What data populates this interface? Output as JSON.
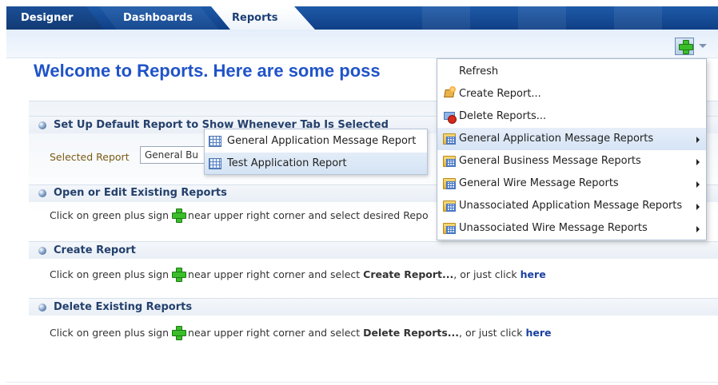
{
  "tabs": [
    {
      "label": "Designer"
    },
    {
      "label": "Dashboards"
    },
    {
      "label": "Reports"
    }
  ],
  "welcome_text": "Welcome to Reports.  Here are some poss",
  "default_section": {
    "title": "Set Up Default Report to Show Whenever Tab Is Selected",
    "selected_label": "Selected Report",
    "selected_value": "General Bu"
  },
  "open_section": {
    "title": "Open or Edit Existing Reports",
    "text_before": "Click on green plus sign",
    "text_after": "near upper right corner and select desired Repo"
  },
  "create_section": {
    "title": "Create Report",
    "text_before": "Click on green plus sign",
    "text_mid": "near upper right corner and select",
    "bold_item": "Create Report...",
    "text_end": ", or just click",
    "link": "here"
  },
  "delete_section": {
    "title": "Delete Existing Reports",
    "text_before": "Click on green plus sign",
    "text_mid": "near upper right corner and select",
    "bold_item": "Delete Reports...",
    "text_end": ", or just click",
    "link": "here"
  },
  "menu": {
    "items": [
      {
        "label": "Refresh"
      },
      {
        "label": "Create Report..."
      },
      {
        "label": "Delete Reports..."
      },
      {
        "label": "General Application Message Reports"
      },
      {
        "label": "General Business Message Reports"
      },
      {
        "label": "General Wire Message Reports"
      },
      {
        "label": "Unassociated Application Message Reports"
      },
      {
        "label": "Unassociated Wire Message Reports"
      }
    ]
  },
  "submenu": {
    "items": [
      {
        "label": "General Application Message Report"
      },
      {
        "label": "Test Application Report"
      }
    ]
  },
  "colors": {
    "accent": "#1f53c8",
    "tab_bar": "#0f3f86",
    "plus_green": "#3bbd2a",
    "highlight": "#d6e4f5"
  }
}
